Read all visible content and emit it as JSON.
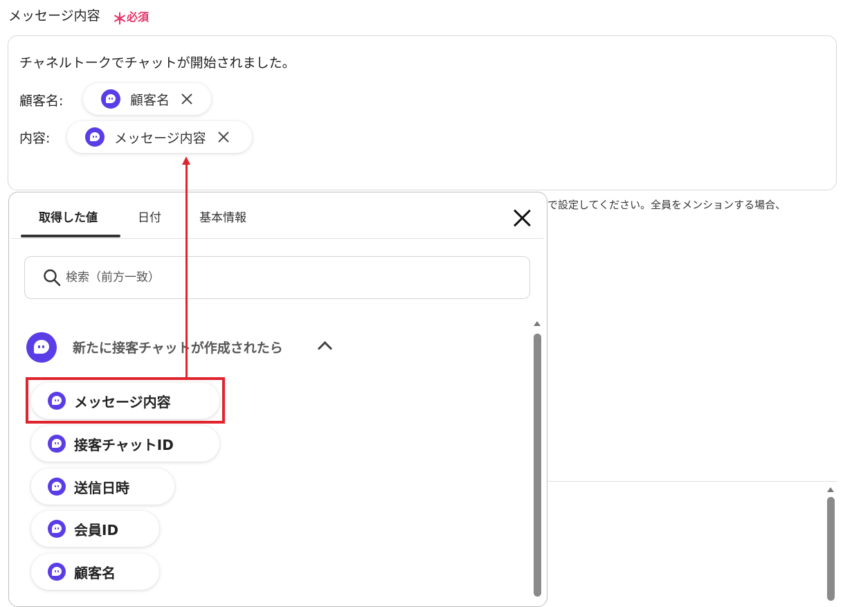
{
  "field": {
    "label": "メッセージ内容",
    "required_mark": "＊",
    "required_text": "必須"
  },
  "message": {
    "line1": "チャネルトークでチャットが開始されました。",
    "customer_label": "顧客名:",
    "customer_token": "顧客名",
    "content_label": "内容:",
    "content_token": "メッセージ内容"
  },
  "help_text": "で設定してください。全員をメンションする場合、",
  "panel": {
    "tabs": [
      {
        "label": "取得した値",
        "active": true
      },
      {
        "label": "日付",
        "active": false
      },
      {
        "label": "基本情報",
        "active": false
      }
    ],
    "search_placeholder": "検索（前方一致）",
    "group": {
      "title": "新たに接客チャットが作成されたら",
      "expanded": true,
      "items": [
        {
          "label": "メッセージ内容",
          "highlighted": true
        },
        {
          "label": "接客チャットID",
          "highlighted": false
        },
        {
          "label": "送信日時",
          "highlighted": false
        },
        {
          "label": "会員ID",
          "highlighted": false
        },
        {
          "label": "顧客名",
          "highlighted": false
        }
      ]
    }
  },
  "colors": {
    "required": "#e4356a",
    "brand_icon": "#5a3de6",
    "annotation": "#e0242e"
  },
  "icons": [
    "channel-talk-icon",
    "close-icon",
    "search-icon",
    "chevron-up-icon"
  ]
}
